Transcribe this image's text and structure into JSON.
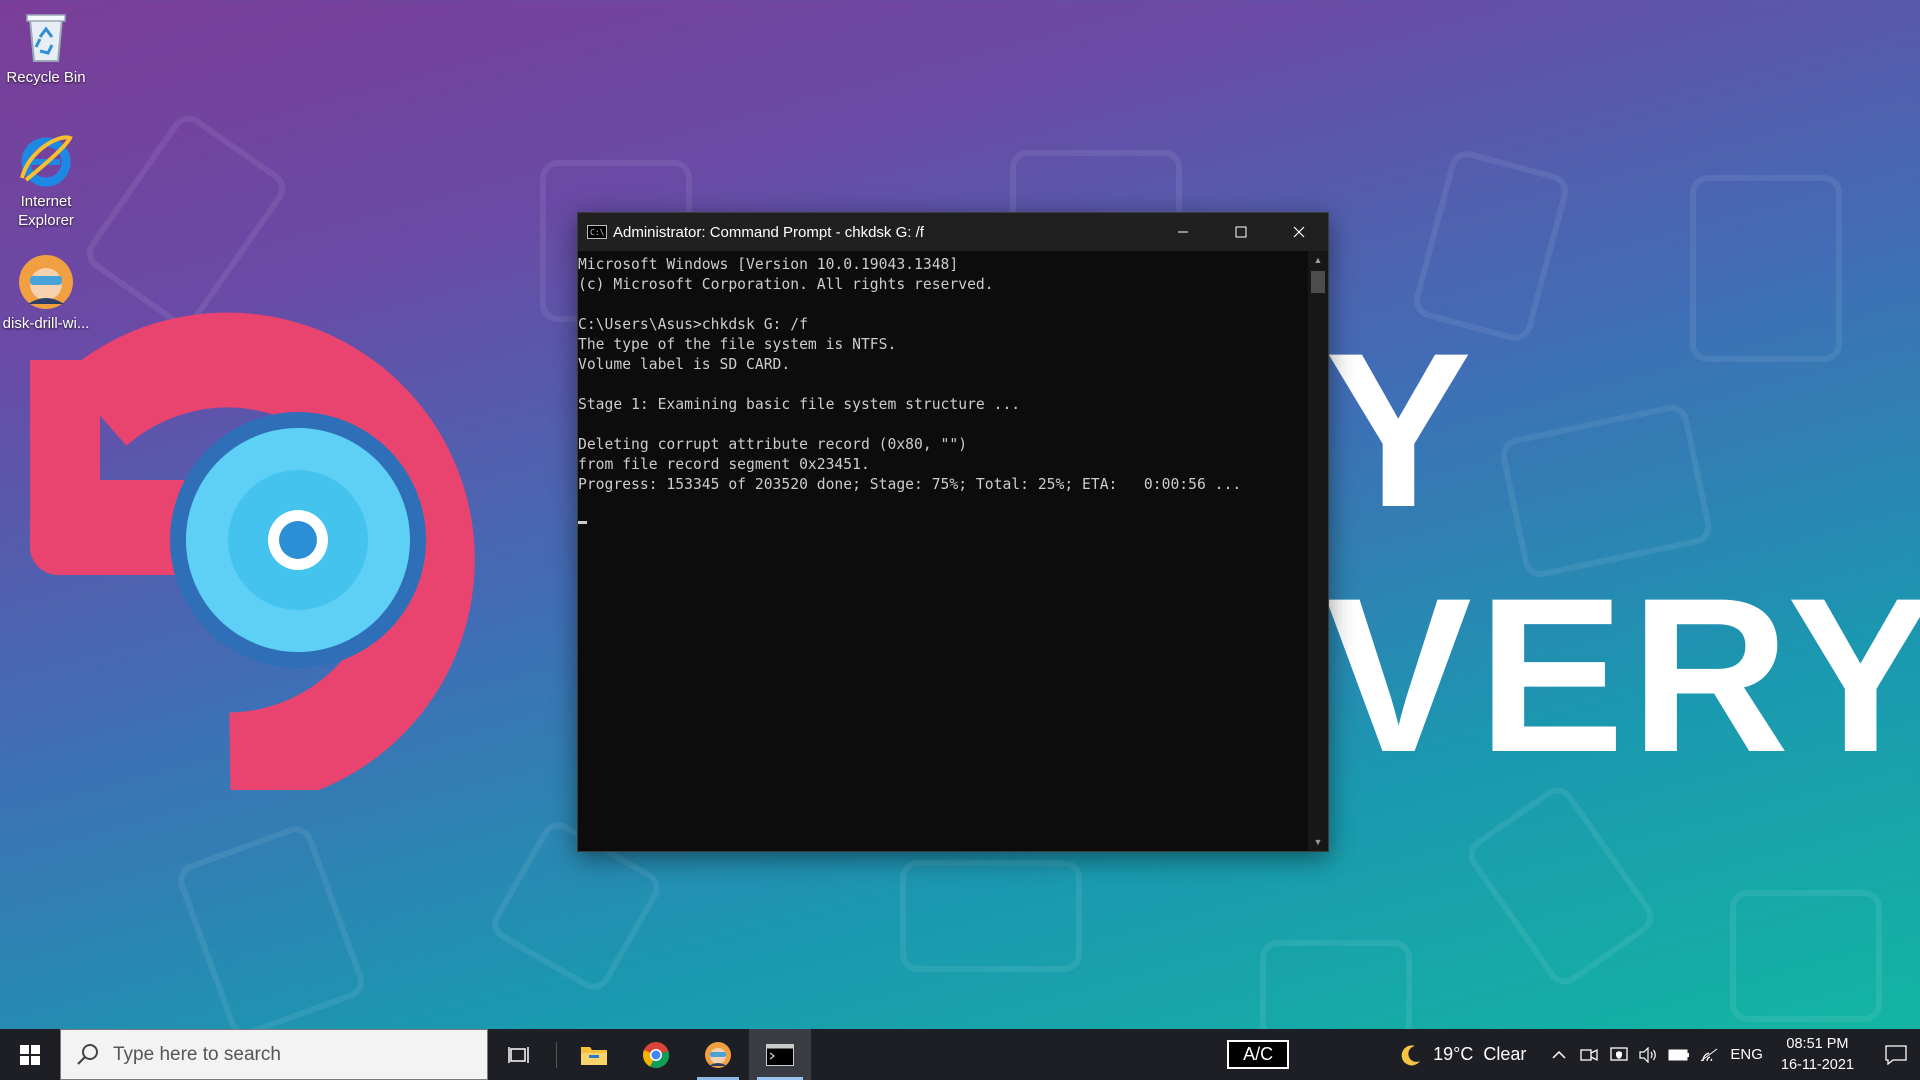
{
  "desktop": {
    "icons": [
      {
        "label": "Recycle Bin",
        "icon": "recycle-bin-icon"
      },
      {
        "label": "Internet Explorer",
        "icon": "internet-explorer-icon"
      },
      {
        "label": "disk-drill-wi...",
        "icon": "disk-drill-icon"
      }
    ],
    "wallpaper": {
      "text_top": "Y",
      "text_bottom": "VERY",
      "accent": "#e9446f",
      "disc": "#5fd0f5"
    }
  },
  "window": {
    "title": "Administrator: Command Prompt - chkdsk  G: /f",
    "icon": "cmd-icon",
    "controls": {
      "minimize": "minimize-icon",
      "maximize": "maximize-icon",
      "close": "close-icon"
    },
    "lines": [
      "Microsoft Windows [Version 10.0.19043.1348]",
      "(c) Microsoft Corporation. All rights reserved.",
      "",
      "C:\\Users\\Asus>chkdsk G: /f",
      "The type of the file system is NTFS.",
      "Volume label is SD CARD.",
      "",
      "Stage 1: Examining basic file system structure ...",
      "",
      "Deleting corrupt attribute record (0x80, \"\")",
      "from file record segment 0x23451.",
      "Progress: 153345 of 203520 done; Stage: 75%; Total: 25%; ETA:   0:00:56 ..."
    ],
    "text_color": "#cccccc",
    "background": "#0c0c0c"
  },
  "taskbar": {
    "search_placeholder": "Type here to search",
    "apps": [
      {
        "name": "task-view-icon"
      },
      {
        "name": "file-explorer-icon"
      },
      {
        "name": "chrome-icon"
      },
      {
        "name": "disk-drill-icon"
      },
      {
        "name": "command-prompt-icon"
      }
    ],
    "ac_label": "A/C",
    "weather": "19°C  Clear",
    "language": "ENG",
    "time": "08:51 PM",
    "date": "16-11-2021"
  }
}
